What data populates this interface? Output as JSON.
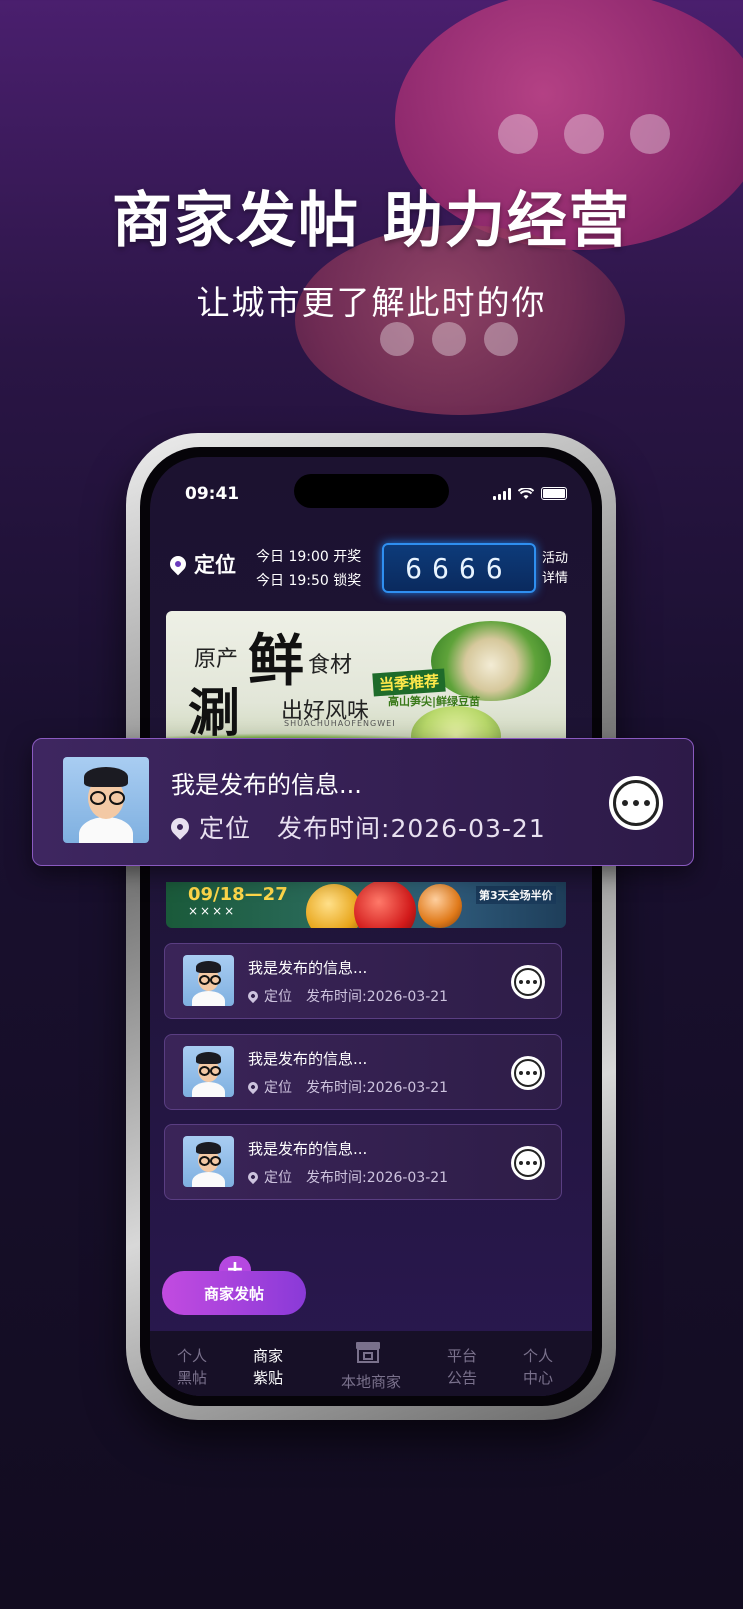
{
  "headline": "商家发帖 助力经营",
  "subheadline": "让城市更了解此时的你",
  "status_bar": {
    "time": "09:41"
  },
  "top_bar": {
    "location_label": "定位",
    "open_time": "今日 19:00 开奖",
    "lock_time": "今日 19:50 锁奖",
    "counter": "6666",
    "activity_line1": "活动",
    "activity_line2": "详情"
  },
  "banner": {
    "text_origin": "原产",
    "text_fresh": "鲜",
    "text_ingredients": "食材",
    "text_rinse": "涮",
    "text_flavor": "出好风味",
    "pinyin": "SHUACHUHAOFENGWEI",
    "tag": "当季推荐",
    "tag_sub": "高山笋尖|鲜绿豆苗"
  },
  "banner2": {
    "date": "09/18—27",
    "sub": "××××",
    "right_text": "第3天全场半价"
  },
  "featured_post": {
    "title": "我是发布的信息...",
    "location": "定位",
    "publish_time": "发布时间:2026-03-21"
  },
  "posts": [
    {
      "title": "我是发布的信息...",
      "location": "定位",
      "publish_time": "发布时间:2026-03-21"
    },
    {
      "title": "我是发布的信息...",
      "location": "定位",
      "publish_time": "发布时间:2026-03-21"
    },
    {
      "title": "我是发布的信息...",
      "location": "定位",
      "publish_time": "发布时间:2026-03-21"
    }
  ],
  "post_button": "商家发帖",
  "tabs": [
    {
      "line1": "个人",
      "line2": "黑帖"
    },
    {
      "line1": "商家",
      "line2": "紫贴"
    },
    {
      "line1": "本地商家",
      "line2": ""
    },
    {
      "line1": "平台",
      "line2": "公告"
    },
    {
      "line1": "个人",
      "line2": "中心"
    }
  ],
  "active_tab": "商家紫贴",
  "colors": {
    "accent": "#b548e0",
    "counter_bg": "#0d3b7a"
  }
}
